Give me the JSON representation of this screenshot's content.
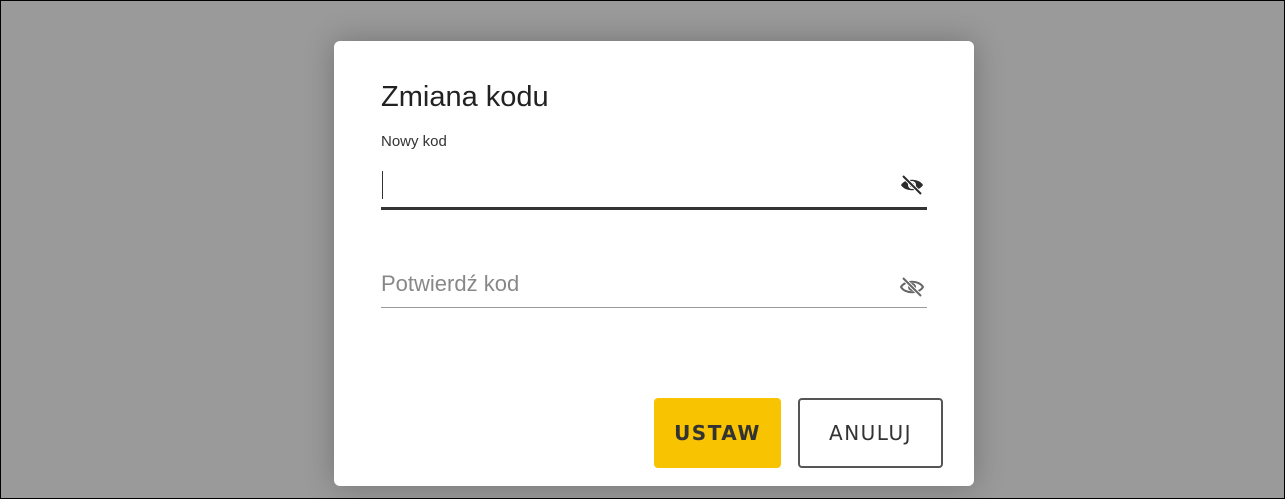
{
  "dialog": {
    "title": "Zmiana kodu"
  },
  "new_code": {
    "label": "Nowy kod",
    "value": "",
    "placeholder": ""
  },
  "confirm_code": {
    "label": "",
    "value": "",
    "placeholder": "Potwierdź kod"
  },
  "buttons": {
    "set_label": "USTAW",
    "cancel_label": "ANULUJ"
  },
  "icons": {
    "visibility_toggle": "eye-off-icon"
  },
  "colors": {
    "backdrop": "#9a9a9a",
    "primary_button": "#f8c300",
    "text": "#222222"
  }
}
